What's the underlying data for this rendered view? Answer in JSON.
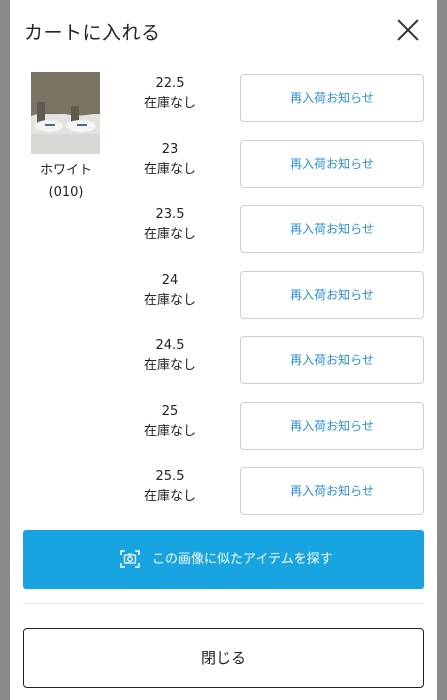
{
  "header": {
    "title": "カートに入れる",
    "close_icon": "close-icon"
  },
  "product": {
    "color_name": "ホワイト",
    "color_code": "(010)"
  },
  "sizes": [
    {
      "size": "22.5",
      "stock": "在庫なし",
      "button": "再入荷お知らせ"
    },
    {
      "size": "23",
      "stock": "在庫なし",
      "button": "再入荷お知らせ"
    },
    {
      "size": "23.5",
      "stock": "在庫なし",
      "button": "再入荷お知らせ"
    },
    {
      "size": "24",
      "stock": "在庫なし",
      "button": "再入荷お知らせ"
    },
    {
      "size": "24.5",
      "stock": "在庫なし",
      "button": "再入荷お知らせ"
    },
    {
      "size": "25",
      "stock": "在庫なし",
      "button": "再入荷お知らせ"
    },
    {
      "size": "25.5",
      "stock": "在庫なし",
      "button": "再入荷お知らせ"
    }
  ],
  "similar_search": {
    "label": "この画像に似たアイテムを探す",
    "icon": "camera-search-icon"
  },
  "footer": {
    "close_label": "閉じる"
  },
  "colors": {
    "accent": "#17a4e0",
    "link": "#2a8fd6",
    "overlay": "#8a8a8a"
  }
}
